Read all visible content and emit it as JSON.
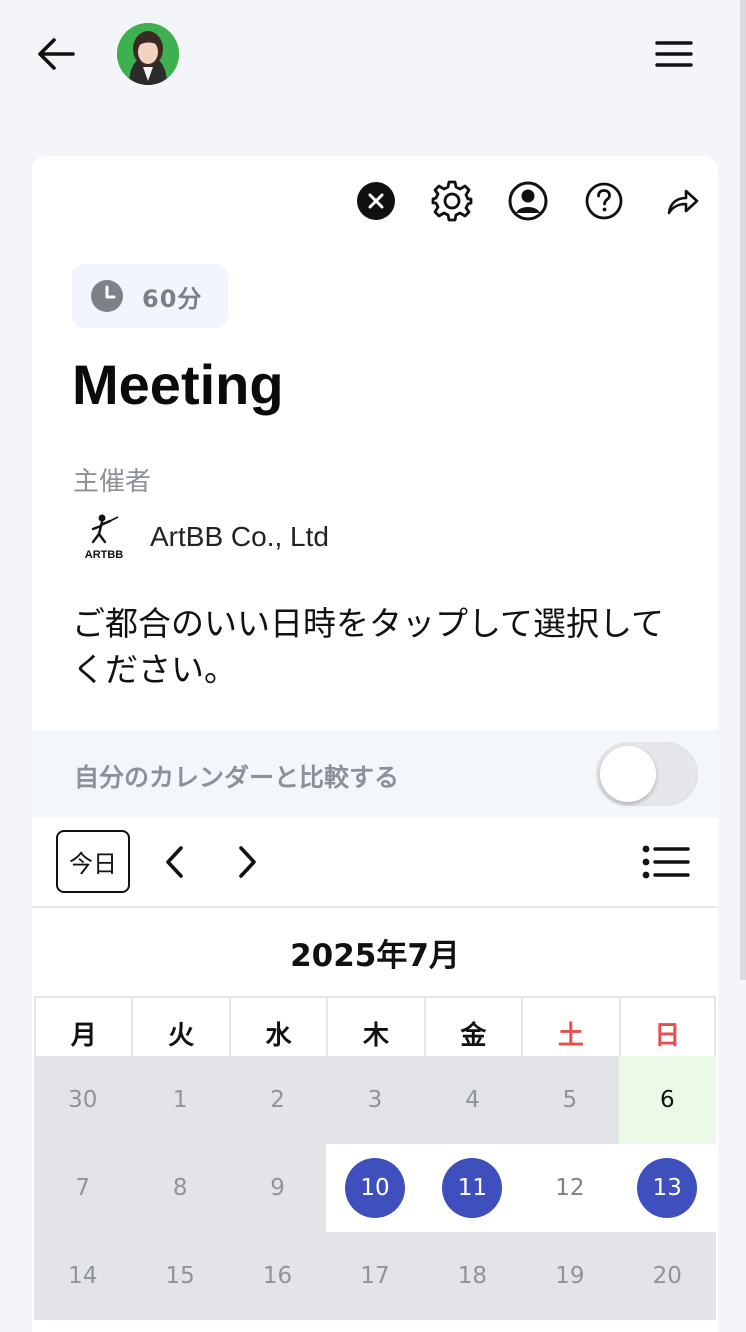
{
  "header": {
    "back_icon": "arrow-left-icon",
    "avatar": "user-avatar",
    "menu_icon": "hamburger-menu-icon"
  },
  "card": {
    "toolbar": [
      "close-icon",
      "gear-icon",
      "account-icon",
      "help-icon",
      "share-icon"
    ],
    "duration_icon": "clock-icon",
    "duration": "60分",
    "title": "Meeting",
    "organizer_label": "主催者",
    "organizer_logo_text": "ARTBB",
    "organizer_name": "ArtBB Co., Ltd",
    "instructions": "ご都合のいい日時をタップして選択してください。"
  },
  "compare": {
    "label": "自分のカレンダーと比較する",
    "toggle_on": false
  },
  "calendar": {
    "today_label": "今日",
    "month_title": "2025年7月",
    "weekdays": [
      "月",
      "火",
      "水",
      "木",
      "金",
      "土",
      "日"
    ],
    "colors": {
      "weekend": "#e8504f",
      "selected": "#3f4fbd",
      "today_bg": "#eafae6"
    },
    "weeks": [
      [
        "30",
        "1",
        "2",
        "3",
        "4",
        "5",
        "6"
      ],
      [
        "7",
        "8",
        "9",
        "10",
        "11",
        "12",
        "13"
      ],
      [
        "14",
        "15",
        "16",
        "17",
        "18",
        "19",
        "20"
      ]
    ]
  }
}
